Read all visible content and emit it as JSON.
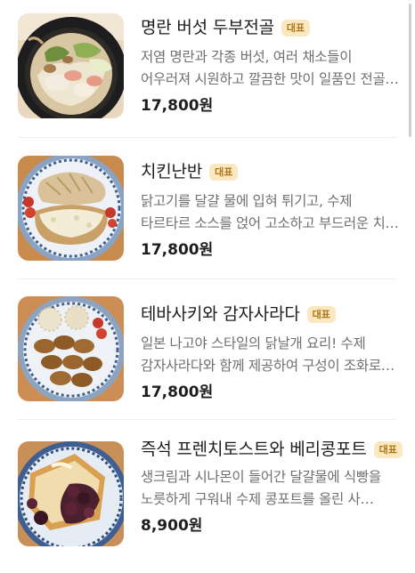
{
  "menu": {
    "items": [
      {
        "name": "명란 버섯 두부전골",
        "badge": "대표",
        "description": "저염 명란과 각종 버섯, 여러 채소들이 어우러져 시원하고 깔끔한 맛이 일품인 전골…",
        "price": "17,800원",
        "image": "hotpot-food-photo"
      },
      {
        "name": "치킨난반",
        "badge": "대표",
        "description": "닭고기를 달걀 물에 입혀 튀기고, 수제 타르타르 소스를 얹어 고소하고 부드러운 치…",
        "price": "17,800원",
        "image": "chicken-nanban-food-photo"
      },
      {
        "name": "테바사키와 감자사라다",
        "badge": "대표",
        "description": "일본 나고야 스타일의 닭날개 요리! 수제 감자사라다와 함께 제공하여 구성이 조화로…",
        "price": "17,800원",
        "image": "tebasaki-food-photo"
      },
      {
        "name": "즉석 프렌치토스트와 베리콩포트",
        "badge": "대표",
        "description": "생크림과 시나몬이 들어간 달걀물에 식빵을 노릇하게 구워내 수제 콩포트를 올린 사…",
        "price": "8,900원",
        "image": "french-toast-food-photo"
      }
    ]
  },
  "colors": {
    "badge_bg": "#fbe7c0",
    "badge_text": "#b07718",
    "price": "#1e1e1e",
    "description": "#6f6f6f"
  }
}
